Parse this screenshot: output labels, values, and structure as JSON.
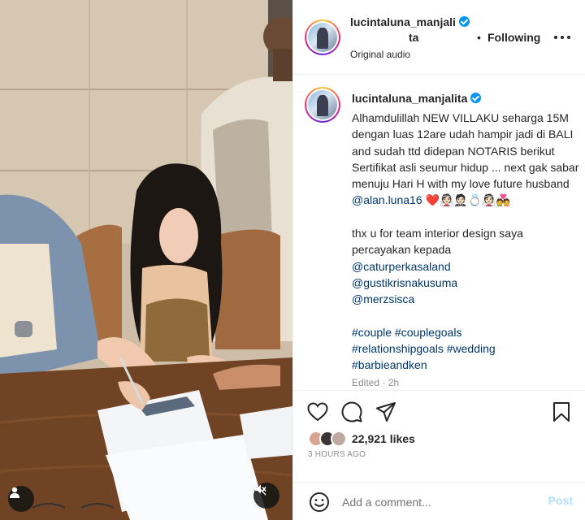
{
  "post": {
    "username_line1": "lucintaluna_manjali",
    "username_line2": "ta",
    "follow_separator": "•",
    "follow_label": "Following",
    "audio_label": "Original audio",
    "more_icon": "more-horizontal-icon"
  },
  "caption": {
    "username": "lucintaluna_manjalita",
    "body_part1": "Alhamdulillah NEW VILLAKU seharga 15M dengan luas 12are udah hampir jadi di BALI and sudah ttd didepan NOTARIS berikut Sertifikat asli seumur hidup ... next gak sabar menuju Hari H with my love future husband ",
    "mention_husband": "@alan.luna16",
    "emojis": " ❤️👰🏻🤵🏻💍👰🏻💑",
    "body_part2": "thx u for team interior design saya percayakan kepada",
    "mentions": [
      "@caturperkasaland",
      "@gustikrisnakusuma",
      "@merzsisca"
    ],
    "hashtags_line1": "#couple #couplegoals",
    "hashtags_line2": "#relationshipgoals #wedding",
    "hashtags_line3": "#barbieandken",
    "edited": "Edited · 2h"
  },
  "engagement": {
    "likes": "22,921 likes",
    "timestamp": "3 HOURS AGO",
    "comment_placeholder": "Add a comment...",
    "post_label": "Post"
  },
  "colors": {
    "link": "#00376b",
    "verified": "#0095f6",
    "post_disabled": "#b2dffc",
    "muted": "#8e8e8e"
  }
}
